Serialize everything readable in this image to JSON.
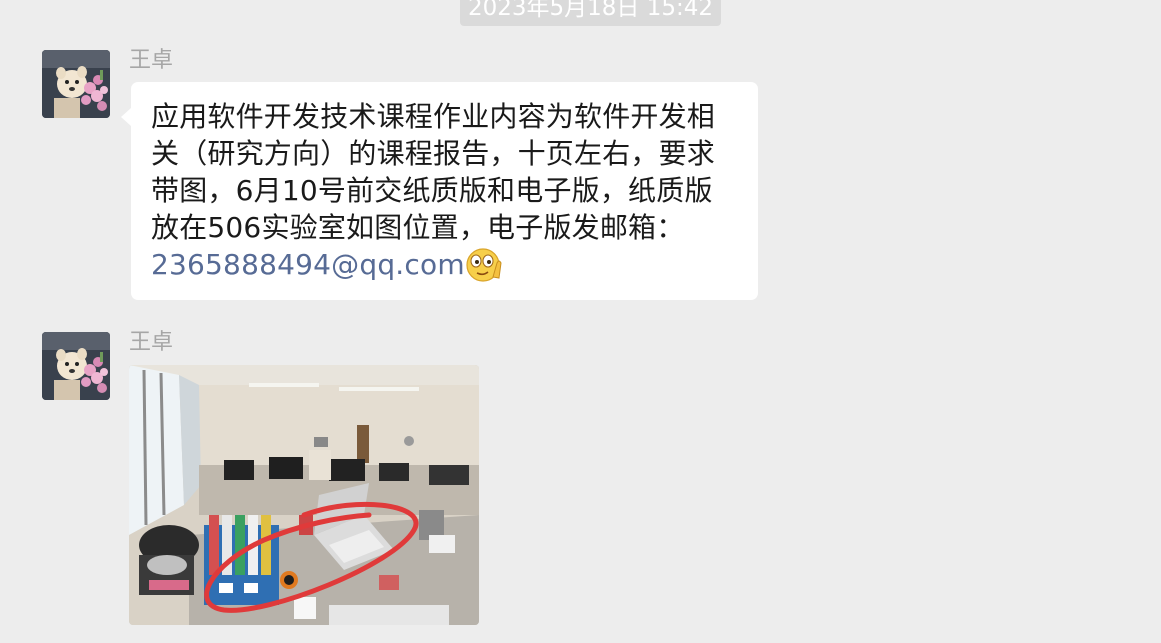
{
  "timestamp": "2023年5月18日 15:42",
  "messages": [
    {
      "sender": "王卓",
      "type": "text",
      "text": "应用软件开发技术课程作业内容为软件开发相关（研究方向）的课程报告，十页左右，要求带图，6月10号前交纸质版和电子版，纸质版放在506实验室如图位置，电子版发邮箱：",
      "email": "2365888494@qq.com",
      "emoji": "smirk-face-icon"
    },
    {
      "sender": "王卓",
      "type": "image"
    }
  ],
  "colors": {
    "background": "#ededed",
    "bubble": "#ffffff",
    "link": "#576b95",
    "sender_name": "#a6a6a6",
    "annotation_circle": "#e03a3a"
  }
}
